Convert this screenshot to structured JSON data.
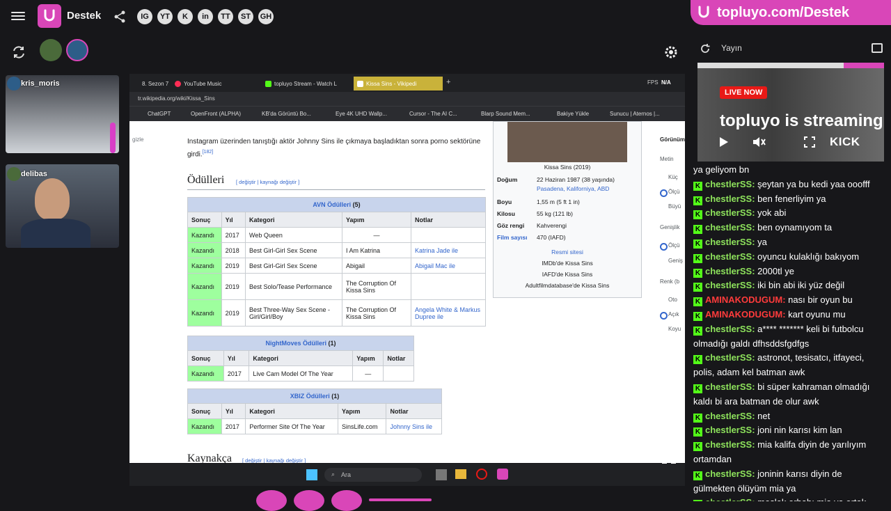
{
  "header": {
    "brand": "Destek"
  },
  "social": [
    "IG",
    "YT",
    "K",
    "in",
    "TT",
    "ST",
    "GH"
  ],
  "cams": [
    {
      "name": "kris_moris"
    },
    {
      "name": "delibas"
    }
  ],
  "browser": {
    "tabs": [
      {
        "label": "8. Sezon 7"
      },
      {
        "label": "YouTube Music"
      },
      {
        "label": "topluyo Stream - Watch L"
      },
      {
        "label": "Kissa Sins - Vikipedi"
      }
    ],
    "address": "tr.wikipedia.org/wiki/Kissa_Sins",
    "bookmarks": [
      "ChatGPT",
      "OpenFront (ALPHA)",
      "KB'da Görüntü Bo...",
      "Eye 4K UHD Wallp...",
      "Cursor - The AI C...",
      "Blarp Sound Mem...",
      "Bakiye Yükle",
      "Sunucu | Aternos |..."
    ]
  },
  "wiki": {
    "intro": "Instagram üzerinden tanıştığı aktör Johnny Sins ile çıkmaya başladıktan sonra porno sektörüne girdi.",
    "intro_ref": "[182]",
    "awards_heading": "Ödülleri",
    "edit_links": "[ değiştir | kaynağı değiştir ]",
    "headers": [
      "Sonuç",
      "Yıl",
      "Kategori",
      "Yapım",
      "Notlar"
    ],
    "avn": {
      "caption": "AVN Ödülleri",
      "count": "(5)",
      "rows": [
        [
          "Kazandı",
          "2017",
          "Web Queen",
          "—",
          ""
        ],
        [
          "Kazandı",
          "2018",
          "Best Girl-Girl Sex Scene",
          "I Am Katrina",
          "Katrina Jade ile"
        ],
        [
          "Kazandı",
          "2019",
          "Best Girl-Girl Sex Scene",
          "Abigail",
          "Abigail Mac ile"
        ],
        [
          "Kazandı",
          "2019",
          "Best Solo/Tease Performance",
          "The Corruption Of Kissa Sins",
          ""
        ],
        [
          "Kazandı",
          "2019",
          "Best Three-Way Sex Scene - Girl/Girl/Boy",
          "The Corruption Of Kissa Sins",
          "Angela White & Markus Dupree ile"
        ]
      ]
    },
    "nightmoves": {
      "caption": "NightMoves Ödülleri",
      "count": "(1)",
      "rows": [
        [
          "Kazandı",
          "2017",
          "Live Cam Model Of The Year",
          "—",
          ""
        ]
      ]
    },
    "xbiz": {
      "caption": "XBIZ Ödülleri",
      "count": "(1)",
      "rows": [
        [
          "Kazandı",
          "2017",
          "Performer Site Of The Year",
          "SinsLife.com",
          "Johnny Sins ile"
        ]
      ]
    },
    "refs_heading": "Kaynakça",
    "refs_edit": "[ değiştir | kaynağı değiştir ]",
    "infobox": {
      "caption": "Kissa Sins (2019)",
      "rows": [
        {
          "k": "Doğum",
          "v": "22 Haziran 1987 (38 yaşında)",
          "v2": "Pasadena, Kaliforniya, ABD"
        },
        {
          "k": "Boyu",
          "v": "1,55 m (5 ft 1 in)"
        },
        {
          "k": "Kilosu",
          "v": "55 kg (121 lb)"
        },
        {
          "k": "Göz rengi",
          "v": "Kahverengi"
        },
        {
          "k": "Film sayısı",
          "v": "470 (IAFD)"
        }
      ],
      "links": [
        "Resmi sitesi",
        "IMDb'de Kissa Sins",
        "IAFD'de Kissa Sins",
        "Adultfilmdatabase'de Kissa Sins"
      ]
    },
    "side_labels": [
      "Görünüm",
      "Metin",
      "Küç",
      "Ölçü",
      "Büyü",
      "Genişlik",
      "Ölçü",
      "Geniş",
      "Renk (b",
      "Oto",
      "Açık",
      "Koyu"
    ],
    "gizle": "gizle"
  },
  "browser_right": {
    "fps_label": "FPS",
    "fps_value": "N/A"
  },
  "taskbar": {
    "search": "Ara"
  },
  "panel": {
    "url": "topluyo.com/Destek",
    "title": "Yayın",
    "live": "LIVE NOW",
    "stream_text": "topluyo is streaming",
    "platform": "KICK"
  },
  "chat": [
    {
      "user": "",
      "text": "ya geliyom bn",
      "color": "#ffffff"
    },
    {
      "user": "chestlerSS:",
      "text": "şeytan ya bu kedi yaa ooofff",
      "color": "#8ee35c"
    },
    {
      "user": "chestlerSS:",
      "text": "ben fenerliyim ya",
      "color": "#8ee35c"
    },
    {
      "user": "chestlerSS:",
      "text": "yok abi",
      "color": "#8ee35c"
    },
    {
      "user": "chestlerSS:",
      "text": "ben oynamıyom ta",
      "color": "#8ee35c"
    },
    {
      "user": "chestlerSS:",
      "text": "ya",
      "color": "#8ee35c"
    },
    {
      "user": "chestlerSS:",
      "text": "oyuncu kulaklığı bakıyom",
      "color": "#8ee35c"
    },
    {
      "user": "chestlerSS:",
      "text": "2000tl ye",
      "color": "#8ee35c"
    },
    {
      "user": "chestlerSS:",
      "text": "iki bin abi iki yüz değil",
      "color": "#8ee35c"
    },
    {
      "user": "AMINAKODUGUM:",
      "text": "nası bir oyun bu",
      "color": "#ff3b3b"
    },
    {
      "user": "AMINAKODUGUM:",
      "text": "kart oyunu mu",
      "color": "#ff3b3b"
    },
    {
      "user": "chestlerSS:",
      "text": "a**** ******* keli bi futbolcu olmadığı galdı dfhsddsfgdfgs",
      "color": "#8ee35c"
    },
    {
      "user": "chestlerSS:",
      "text": "astronot, tesisatcı, itfayeci, polis, adam kel batman awk",
      "color": "#8ee35c"
    },
    {
      "user": "chestlerSS:",
      "text": "bi süper kahraman olmadığı kaldı bi ara batman de olur awk",
      "color": "#8ee35c"
    },
    {
      "user": "chestlerSS:",
      "text": "net",
      "color": "#8ee35c"
    },
    {
      "user": "chestlerSS:",
      "text": "joni nin karısı kim lan",
      "color": "#8ee35c"
    },
    {
      "user": "chestlerSS:",
      "text": "mia kalifa diyin de yarılıyım ortamdan",
      "color": "#8ee35c"
    },
    {
      "user": "chestlerSS:",
      "text": "joninin karısı diyin de gülmekten ölüyüm mia ya",
      "color": "#8ee35c"
    },
    {
      "user": "chestlerSS:",
      "text": "meslek erbabı mia ya ortak",
      "color": "#8ee35c"
    }
  ]
}
